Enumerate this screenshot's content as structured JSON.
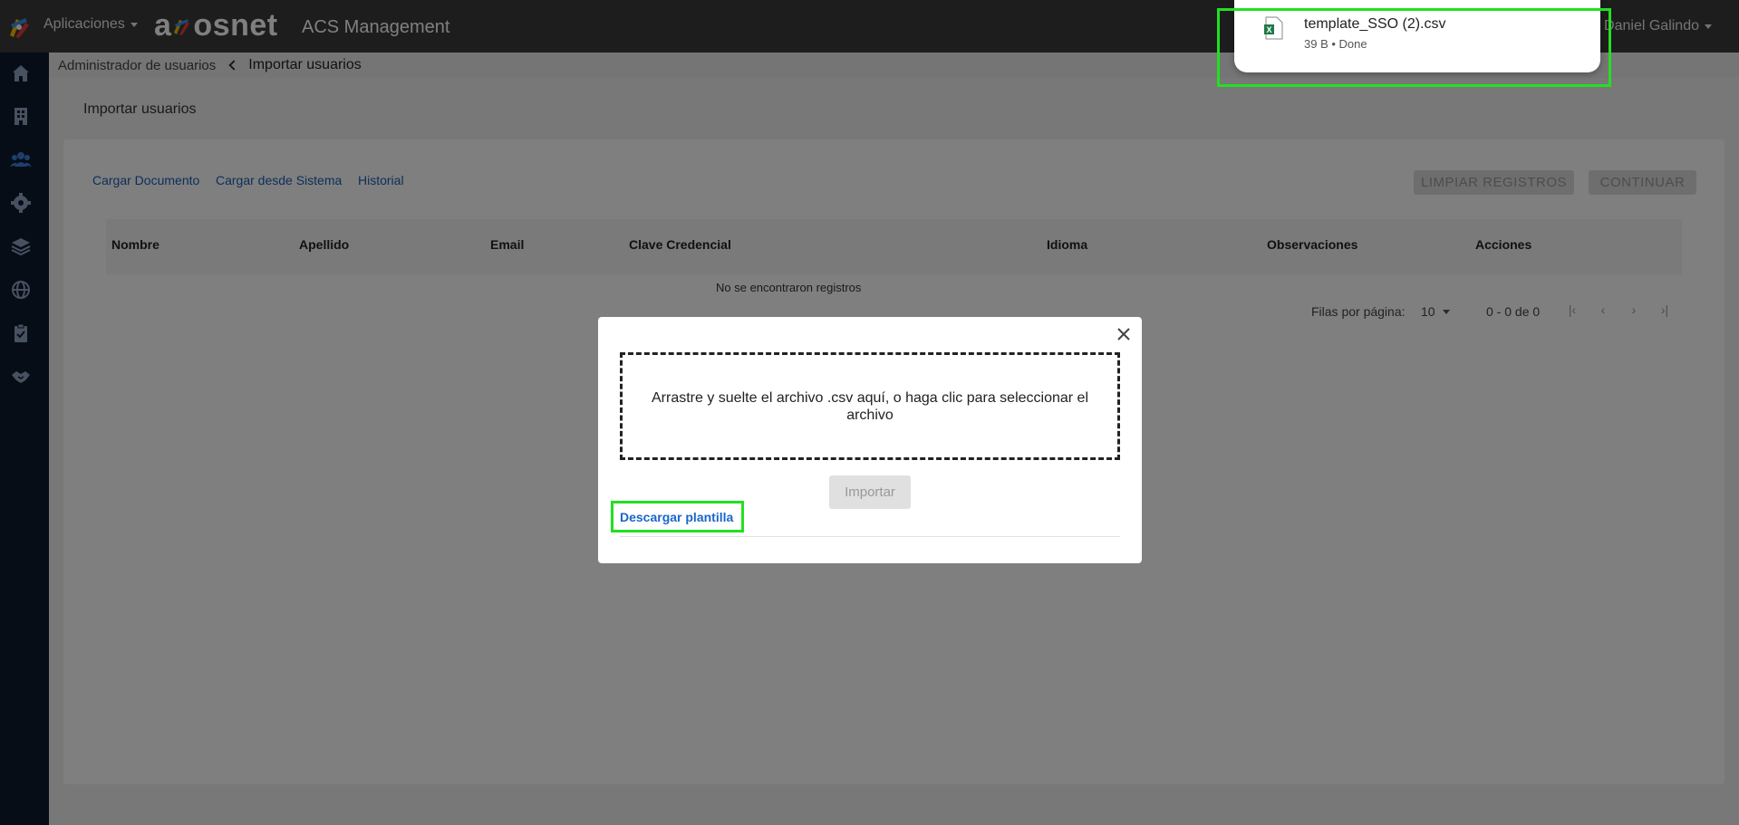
{
  "topbar": {
    "apps_label": "Aplicaciones",
    "brand": "a  osnet",
    "app_title": "ACS Management",
    "user_name": "Daniel Galindo"
  },
  "breadcrumb": {
    "parent": "Administrador de usuarios",
    "current": "Importar usuarios"
  },
  "page": {
    "title": "Importar usuarios",
    "tabs": [
      "Cargar Documento",
      "Cargar desde Sistema",
      "Historial"
    ],
    "buttons": {
      "clear": "LIMPIAR REGISTROS",
      "continue": "CONTINUAR"
    }
  },
  "table": {
    "columns": [
      "Nombre",
      "Apellido",
      "Email",
      "Clave Credencial",
      "Idioma",
      "Observaciones",
      "Acciones"
    ],
    "empty_message": "No se encontraron registros",
    "pager": {
      "rows_label": "Filas por página:",
      "rows_per_page": "10",
      "range": "0 - 0 de 0"
    }
  },
  "modal": {
    "dropzone_text": "Arrastre y suelte el archivo .csv aquí, o haga clic para seleccionar el archivo",
    "import_label": "Importar",
    "download_template": "Descargar plantilla"
  },
  "download_popup": {
    "file_name": "template_SSO (2).csv",
    "status": "39 B • Done"
  },
  "colors": {
    "topbar": "#3a3a3a",
    "sidebar": "#0d1a2e",
    "link": "#1a5fb4",
    "highlight": "#22e022"
  }
}
